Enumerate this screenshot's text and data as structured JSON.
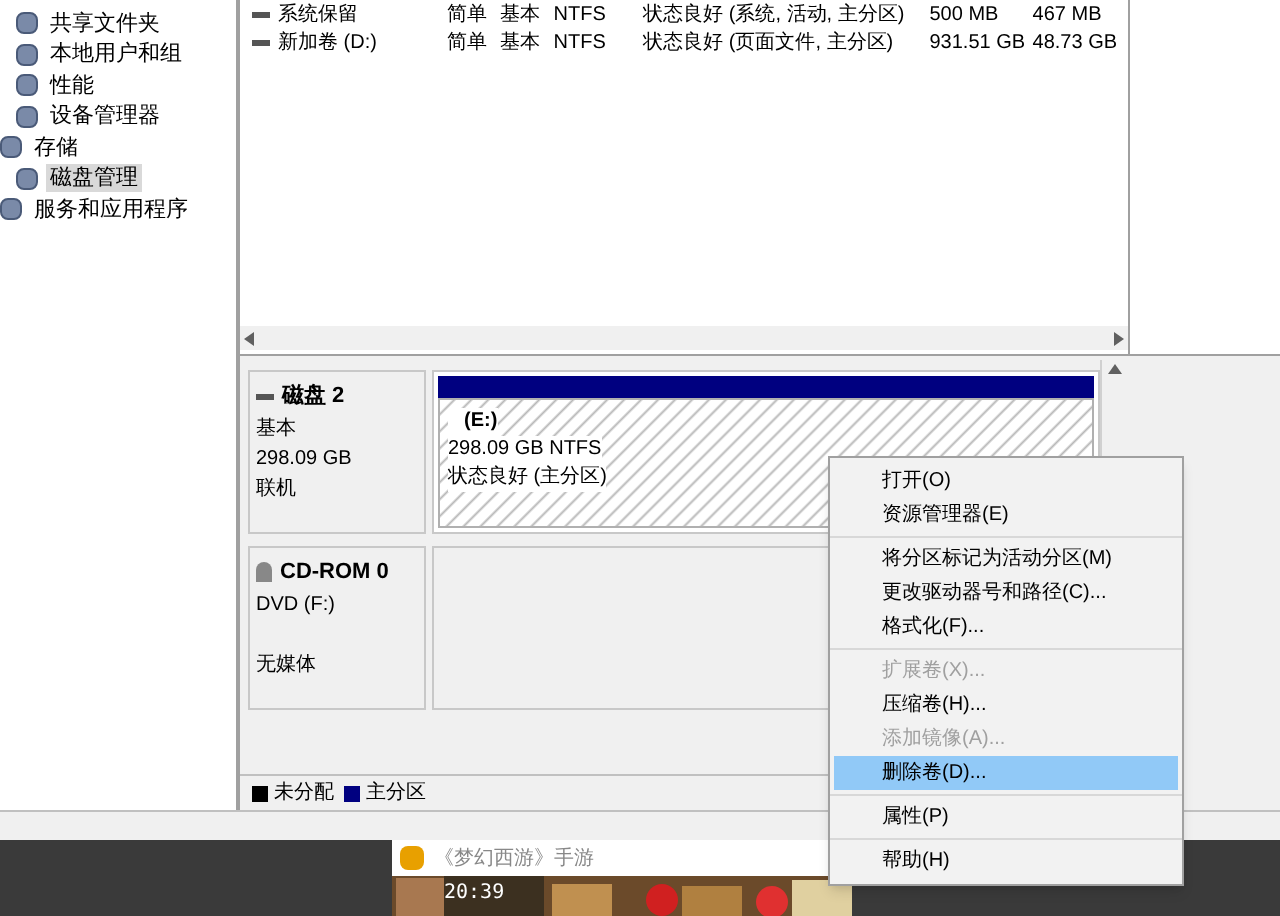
{
  "sidebar": {
    "items": [
      {
        "kind": "tool",
        "label": "共享文件夹",
        "selected": false
      },
      {
        "kind": "tool",
        "label": "本地用户和组",
        "selected": false
      },
      {
        "kind": "tool",
        "label": "性能",
        "selected": false
      },
      {
        "kind": "tool",
        "label": "设备管理器",
        "selected": false
      },
      {
        "kind": "category",
        "label": "存储",
        "selected": false,
        "children": [
          {
            "kind": "tool",
            "label": "磁盘管理",
            "selected": true
          }
        ]
      },
      {
        "kind": "category",
        "label": "服务和应用程序",
        "selected": false
      }
    ]
  },
  "volumes": {
    "rows": [
      {
        "cells": [
          "系统保留",
          "简单",
          "基本",
          "NTFS",
          "状态良好 (系统, 活动, 主分区)",
          "500 MB",
          "467 MB"
        ]
      },
      {
        "cells": [
          "新加卷 (D:)",
          "简单",
          "基本",
          "NTFS",
          "状态良好 (页面文件, 主分区)",
          "931.51 GB",
          "48.73 GB"
        ]
      }
    ]
  },
  "disks": [
    {
      "kind": "disk",
      "name": "磁盘 2",
      "lines": [
        "基本",
        "298.09 GB",
        "联机"
      ],
      "partition": {
        "name": "(E:)",
        "size": "298.09 GB NTFS",
        "status": "状态良好 (主分区)"
      }
    },
    {
      "kind": "cdrom",
      "name": "CD-ROM 0",
      "lines": [
        "DVD (F:)",
        "无媒体"
      ]
    }
  ],
  "legend": [
    {
      "label": "未分配",
      "color": "#000000"
    },
    {
      "label": "主分区",
      "color": "#000080"
    }
  ],
  "context_menu": {
    "groups": [
      [
        {
          "label": "打开(O)",
          "disabled": false,
          "selected": false
        },
        {
          "label": "资源管理器(E)",
          "disabled": false,
          "selected": false
        }
      ],
      [
        {
          "label": "将分区标记为活动分区(M)",
          "disabled": false,
          "selected": false
        },
        {
          "label": "更改驱动器号和路径(C)...",
          "disabled": false,
          "selected": false
        },
        {
          "label": "格式化(F)...",
          "disabled": false,
          "selected": false
        }
      ],
      [
        {
          "label": "扩展卷(X)...",
          "disabled": true,
          "selected": false
        },
        {
          "label": "压缩卷(H)...",
          "disabled": false,
          "selected": false
        },
        {
          "label": "添加镜像(A)...",
          "disabled": true,
          "selected": false
        },
        {
          "label": "删除卷(D)...",
          "disabled": false,
          "selected": true
        }
      ],
      [
        {
          "label": "属性(P)",
          "disabled": false,
          "selected": false
        }
      ],
      [
        {
          "label": "帮助(H)",
          "disabled": false,
          "selected": false
        }
      ]
    ]
  },
  "notification": {
    "title": "《梦幻西游》手游",
    "time": "20:39"
  }
}
